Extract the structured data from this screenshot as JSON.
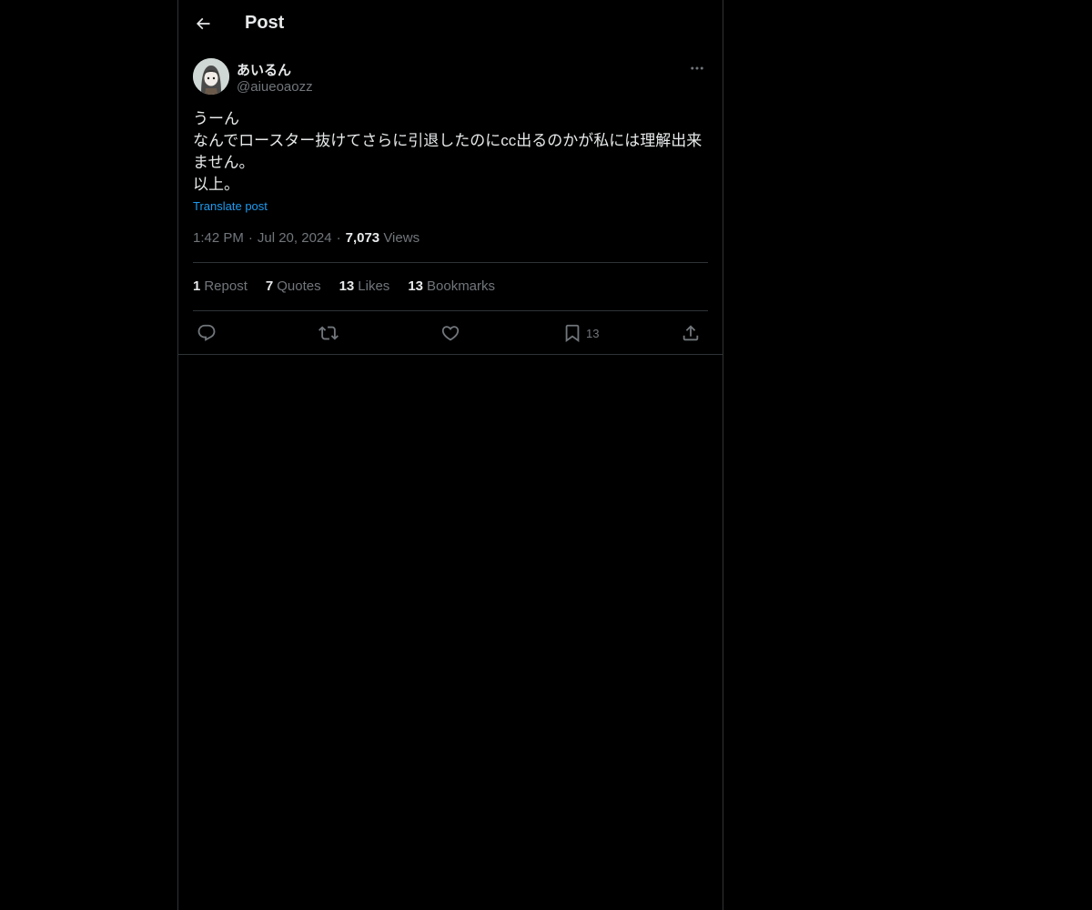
{
  "header": {
    "back_icon": "arrow-left-icon",
    "title": "Post"
  },
  "author": {
    "display_name": "あいるん",
    "handle": "@aiueoaozz",
    "avatar_icon": "avatar-illustration",
    "more_icon": "more-horizontal-icon"
  },
  "post": {
    "text": "うーん\nなんでロースター抜けてさらに引退したのにcc出るのかが私には理解出来ません。\n以上。",
    "translate_label": "Translate post",
    "time": "1:42 PM",
    "date": "Jul 20, 2024",
    "views_count": "7,073",
    "views_label": "Views"
  },
  "stats": [
    {
      "count": "1",
      "label": "Repost"
    },
    {
      "count": "7",
      "label": "Quotes"
    },
    {
      "count": "13",
      "label": "Likes"
    },
    {
      "count": "13",
      "label": "Bookmarks"
    }
  ],
  "actions": {
    "reply_icon": "reply-icon",
    "repost_icon": "repost-icon",
    "like_icon": "heart-icon",
    "bookmark_icon": "bookmark-icon",
    "bookmark_count": "13",
    "share_icon": "share-icon"
  },
  "colors": {
    "background": "#000000",
    "text": "#e7e9ea",
    "muted": "#71767b",
    "link": "#1d9bf0",
    "border": "#2f3336"
  }
}
